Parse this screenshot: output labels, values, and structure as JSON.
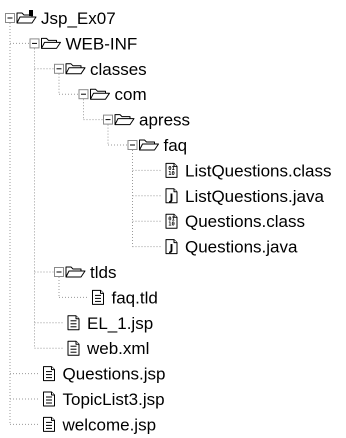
{
  "project_tree": {
    "nodes": [
      {
        "label": "Jsp_Ex07",
        "type": "project",
        "depth": 0,
        "expanded": true,
        "last_child": true
      },
      {
        "label": "WEB-INF",
        "type": "folder",
        "depth": 1,
        "expanded": true,
        "last_child": false
      },
      {
        "label": "classes",
        "type": "folder",
        "depth": 2,
        "expanded": true,
        "last_child": false
      },
      {
        "label": "com",
        "type": "folder",
        "depth": 3,
        "expanded": true,
        "last_child": true
      },
      {
        "label": "apress",
        "type": "folder",
        "depth": 4,
        "expanded": true,
        "last_child": true
      },
      {
        "label": "faq",
        "type": "folder",
        "depth": 5,
        "expanded": true,
        "last_child": true
      },
      {
        "label": "ListQuestions.class",
        "type": "class-file",
        "depth": 6,
        "last_child": false
      },
      {
        "label": "ListQuestions.java",
        "type": "java-file",
        "depth": 6,
        "last_child": false
      },
      {
        "label": "Questions.class",
        "type": "class-file",
        "depth": 6,
        "last_child": false
      },
      {
        "label": "Questions.java",
        "type": "java-file",
        "depth": 6,
        "last_child": true
      },
      {
        "label": "tlds",
        "type": "folder",
        "depth": 2,
        "expanded": true,
        "last_child": false
      },
      {
        "label": "faq.tld",
        "type": "text-file",
        "depth": 3,
        "last_child": true
      },
      {
        "label": "EL_1.jsp",
        "type": "text-file",
        "depth": 2,
        "last_child": false
      },
      {
        "label": "web.xml",
        "type": "text-file",
        "depth": 2,
        "last_child": true
      },
      {
        "label": "Questions.jsp",
        "type": "text-file",
        "depth": 1,
        "last_child": false
      },
      {
        "label": "TopicList3.jsp",
        "type": "text-file",
        "depth": 1,
        "last_child": false
      },
      {
        "label": "welcome.jsp",
        "type": "text-file",
        "depth": 1,
        "last_child": true
      }
    ]
  },
  "icon_names": {
    "project": "project-folder-icon",
    "folder": "open-folder-icon",
    "class-file": "class-file-icon",
    "java-file": "java-file-icon",
    "text-file": "text-file-icon"
  },
  "class_file_glyph": "01\n10",
  "java_file_glyph": "J",
  "colors": {
    "background": "#ffffff",
    "text": "#000000",
    "connector": "#9a9a9a"
  }
}
